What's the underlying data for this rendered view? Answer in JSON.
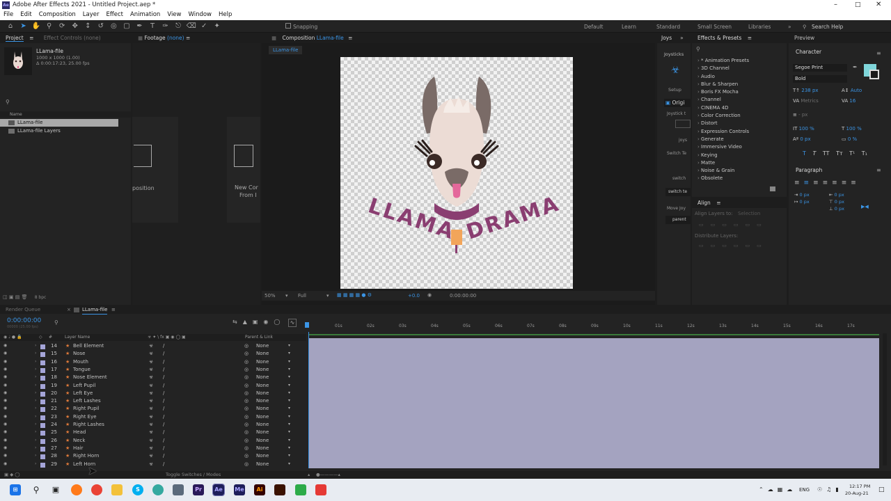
{
  "window": {
    "title": "Adobe After Effects 2021 - Untitled Project.aep *",
    "logo": "Ae"
  },
  "menu": [
    "File",
    "Edit",
    "Composition",
    "Layer",
    "Effect",
    "Animation",
    "View",
    "Window",
    "Help"
  ],
  "toolbar": {
    "snapping_label": "Snapping",
    "workspaces": [
      "Default",
      "Learn",
      "Standard",
      "Small Screen",
      "Libraries"
    ],
    "search_placeholder": "Search Help"
  },
  "project": {
    "tab_project": "Project",
    "tab_effect_controls": "Effect Controls",
    "effect_controls_value": "(none)",
    "item_name": "LLama-file",
    "item_dims": "1000 x 1000 (1.00)",
    "item_duration": "Δ 0:00:17:23, 25.00 fps",
    "col_name": "Name",
    "items": [
      "LLama-file",
      "LLama-file Layers"
    ],
    "bpc": "8 bpc"
  },
  "footage": {
    "tab": "Footage",
    "value": "(none)",
    "card1_label": "position",
    "card2_line1": "New Cor",
    "card2_line2": "From I"
  },
  "composition": {
    "tab_prefix": "Composition",
    "tab_name": "LLama-file",
    "subtab": "LLama-file",
    "art_text_left": "LLAMA",
    "art_text_right": "DRAMA",
    "zoom": "50%",
    "resolution": "Full",
    "time": "0:00:00:00",
    "exposure": "+0.0"
  },
  "joysticks": {
    "tab": "Joys",
    "subtab": "Joysticks",
    "setup": "Setup",
    "origin": "Origi",
    "labels": [
      "Joystick t",
      "joys",
      "Switch Te",
      "switch",
      "switch te",
      "Move Joy",
      "parent"
    ]
  },
  "effects": {
    "tab": "Effects & Presets",
    "items": [
      "* Animation Presets",
      "3D Channel",
      "Audio",
      "Blur & Sharpen",
      "Boris FX Mocha",
      "Channel",
      "CINEMA 4D",
      "Color Correction",
      "Distort",
      "Expression Controls",
      "Generate",
      "Immersive Video",
      "Keying",
      "Matte",
      "Noise & Grain",
      "Obsolete"
    ]
  },
  "align": {
    "tab": "Align",
    "align_to": "Align Layers to:",
    "align_to_value": "Selection",
    "distribute": "Distribute Layers:"
  },
  "character": {
    "preview_tab": "Preview",
    "tab": "Character",
    "font": "Segoe Print",
    "style": "Bold",
    "size": "238 px",
    "leading": "Auto",
    "kerning": "Metrics",
    "tracking": "16",
    "stroke": "- px",
    "vscale": "100 %",
    "hscale": "100 %",
    "baseline": "0 px",
    "tsume": "0 %",
    "styles": [
      "T",
      "T",
      "TT",
      "Tт",
      "T¹",
      "T₁"
    ]
  },
  "paragraph": {
    "tab": "Paragraph",
    "indent_values": [
      "0 px",
      "0 px",
      "0 px",
      "0 px",
      "0 px"
    ]
  },
  "timeline": {
    "tab_render_queue": "Render Queue",
    "tab_comp": "LLama-file",
    "timecode": "0:00:00:00",
    "timecode_sub": "00000 (25.00 fps)",
    "col_layer_name": "Layer Name",
    "col_parent": "Parent & Link",
    "ruler": [
      "01s",
      "02s",
      "03s",
      "04s",
      "05s",
      "06s",
      "07s",
      "08s",
      "09s",
      "10s",
      "11s",
      "12s",
      "13s",
      "14s",
      "15s",
      "16s",
      "17s"
    ],
    "layers": [
      {
        "num": "14",
        "name": "Bell Element",
        "parent": "None"
      },
      {
        "num": "15",
        "name": "Nose",
        "parent": "None"
      },
      {
        "num": "16",
        "name": "Mouth",
        "parent": "None"
      },
      {
        "num": "17",
        "name": "Tongue",
        "parent": "None"
      },
      {
        "num": "18",
        "name": "Nose Element",
        "parent": "None"
      },
      {
        "num": "19",
        "name": "Left Pupil",
        "parent": "None"
      },
      {
        "num": "20",
        "name": "Left Eye",
        "parent": "None"
      },
      {
        "num": "21",
        "name": "Left Lashes",
        "parent": "None"
      },
      {
        "num": "22",
        "name": "Right Pupil",
        "parent": "None"
      },
      {
        "num": "23",
        "name": "Right Eye",
        "parent": "None"
      },
      {
        "num": "24",
        "name": "Right Lashes",
        "parent": "None"
      },
      {
        "num": "25",
        "name": "Head",
        "parent": "None"
      },
      {
        "num": "26",
        "name": "Neck",
        "parent": "None"
      },
      {
        "num": "27",
        "name": "Hair",
        "parent": "None"
      },
      {
        "num": "28",
        "name": "Right Horn",
        "parent": "None"
      },
      {
        "num": "29",
        "name": "Left Horn",
        "parent": "None"
      }
    ],
    "toggle_label": "Toggle Switches / Modes"
  },
  "taskbar": {
    "lang": "ENG",
    "time": "12:17 PM",
    "date": "20-Aug-21",
    "apps": [
      "windows-icon",
      "search-icon",
      "taskview-icon",
      "firefox-icon",
      "chrome-icon",
      "explorer-icon",
      "skype-icon",
      "edge-icon",
      "calculator-icon",
      "premiere-icon",
      "aftereffects-icon",
      "mediaencoder-icon",
      "illustrator-icon",
      "animate-icon",
      "camtasia-icon",
      "recorder-icon"
    ]
  },
  "colors": {
    "accent": "#3b95e6",
    "timeline_bar": "#a4a3c0",
    "llama_text": "#8a3e71",
    "panel_bg": "#232323"
  }
}
